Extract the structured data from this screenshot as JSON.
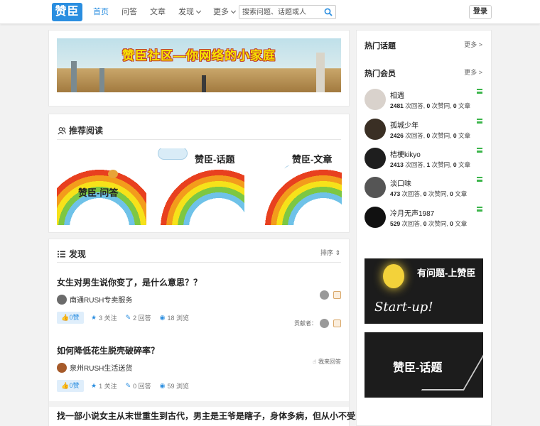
{
  "header": {
    "logo": "赞臣",
    "nav": [
      {
        "label": "首页",
        "active": true
      },
      {
        "label": "问答"
      },
      {
        "label": "文章"
      },
      {
        "label": "发现",
        "dropdown": true
      },
      {
        "label": "更多",
        "dropdown": true
      }
    ],
    "search_placeholder": "搜索问题、话题或人",
    "login_label": "登录"
  },
  "banner": {
    "text": "赞臣社区—你网络的小家庭"
  },
  "recommended": {
    "title": "推荐阅读",
    "tiles": [
      {
        "label": "赞臣-问答"
      },
      {
        "label": "赞臣-话题"
      },
      {
        "label": "赞臣-文章"
      }
    ]
  },
  "feed": {
    "title": "发现",
    "sort_label": "排序",
    "questions": [
      {
        "title": "女生对男生说你变了，是什么意思？？",
        "author": "南通RUSH专卖服务",
        "likes": "0赞",
        "follows": "3 关注",
        "answers": "2 回答",
        "views": "18 浏览",
        "contributors_label": "贡献者："
      },
      {
        "title": "如何降低花生脱壳破碎率？",
        "author": "泉州RUSH生活送货",
        "likes": "0赞",
        "follows": "1 关注",
        "answers": "0 回答",
        "views": "59 浏览",
        "answer_label": "我来回答"
      },
      {
        "title": "找一部小说女主从末世重生到古代，男主是王爷是瞎子，身体多病，但从小不受宠？"
      }
    ]
  },
  "sidebar": {
    "hot_topics_title": "热门话题",
    "hot_members_title": "热门会员",
    "more_label": "更多 >",
    "members": [
      {
        "name": "相遇",
        "answers": "2481",
        "likes": "0",
        "articles": "0"
      },
      {
        "name": "孤城少年",
        "answers": "2426",
        "likes": "0",
        "articles": "0"
      },
      {
        "name": "桔梗kikyo",
        "answers": "2413",
        "likes": "1",
        "articles": "0"
      },
      {
        "name": "淡口味",
        "answers": "473",
        "likes": "0",
        "articles": "0"
      },
      {
        "name": "冷月无声1987",
        "answers": "529",
        "likes": "0",
        "articles": "0"
      }
    ],
    "stat_labels": {
      "answers": " 次回答, ",
      "likes": " 次赞同, ",
      "articles": " 文章"
    },
    "ads": [
      {
        "title": "有问题-上赞臣",
        "sub": "Start-up!"
      },
      {
        "title": "赞臣-话题"
      }
    ]
  },
  "colors": {
    "accent": "#2a8ee0",
    "member_flag": "#3bb54a"
  }
}
